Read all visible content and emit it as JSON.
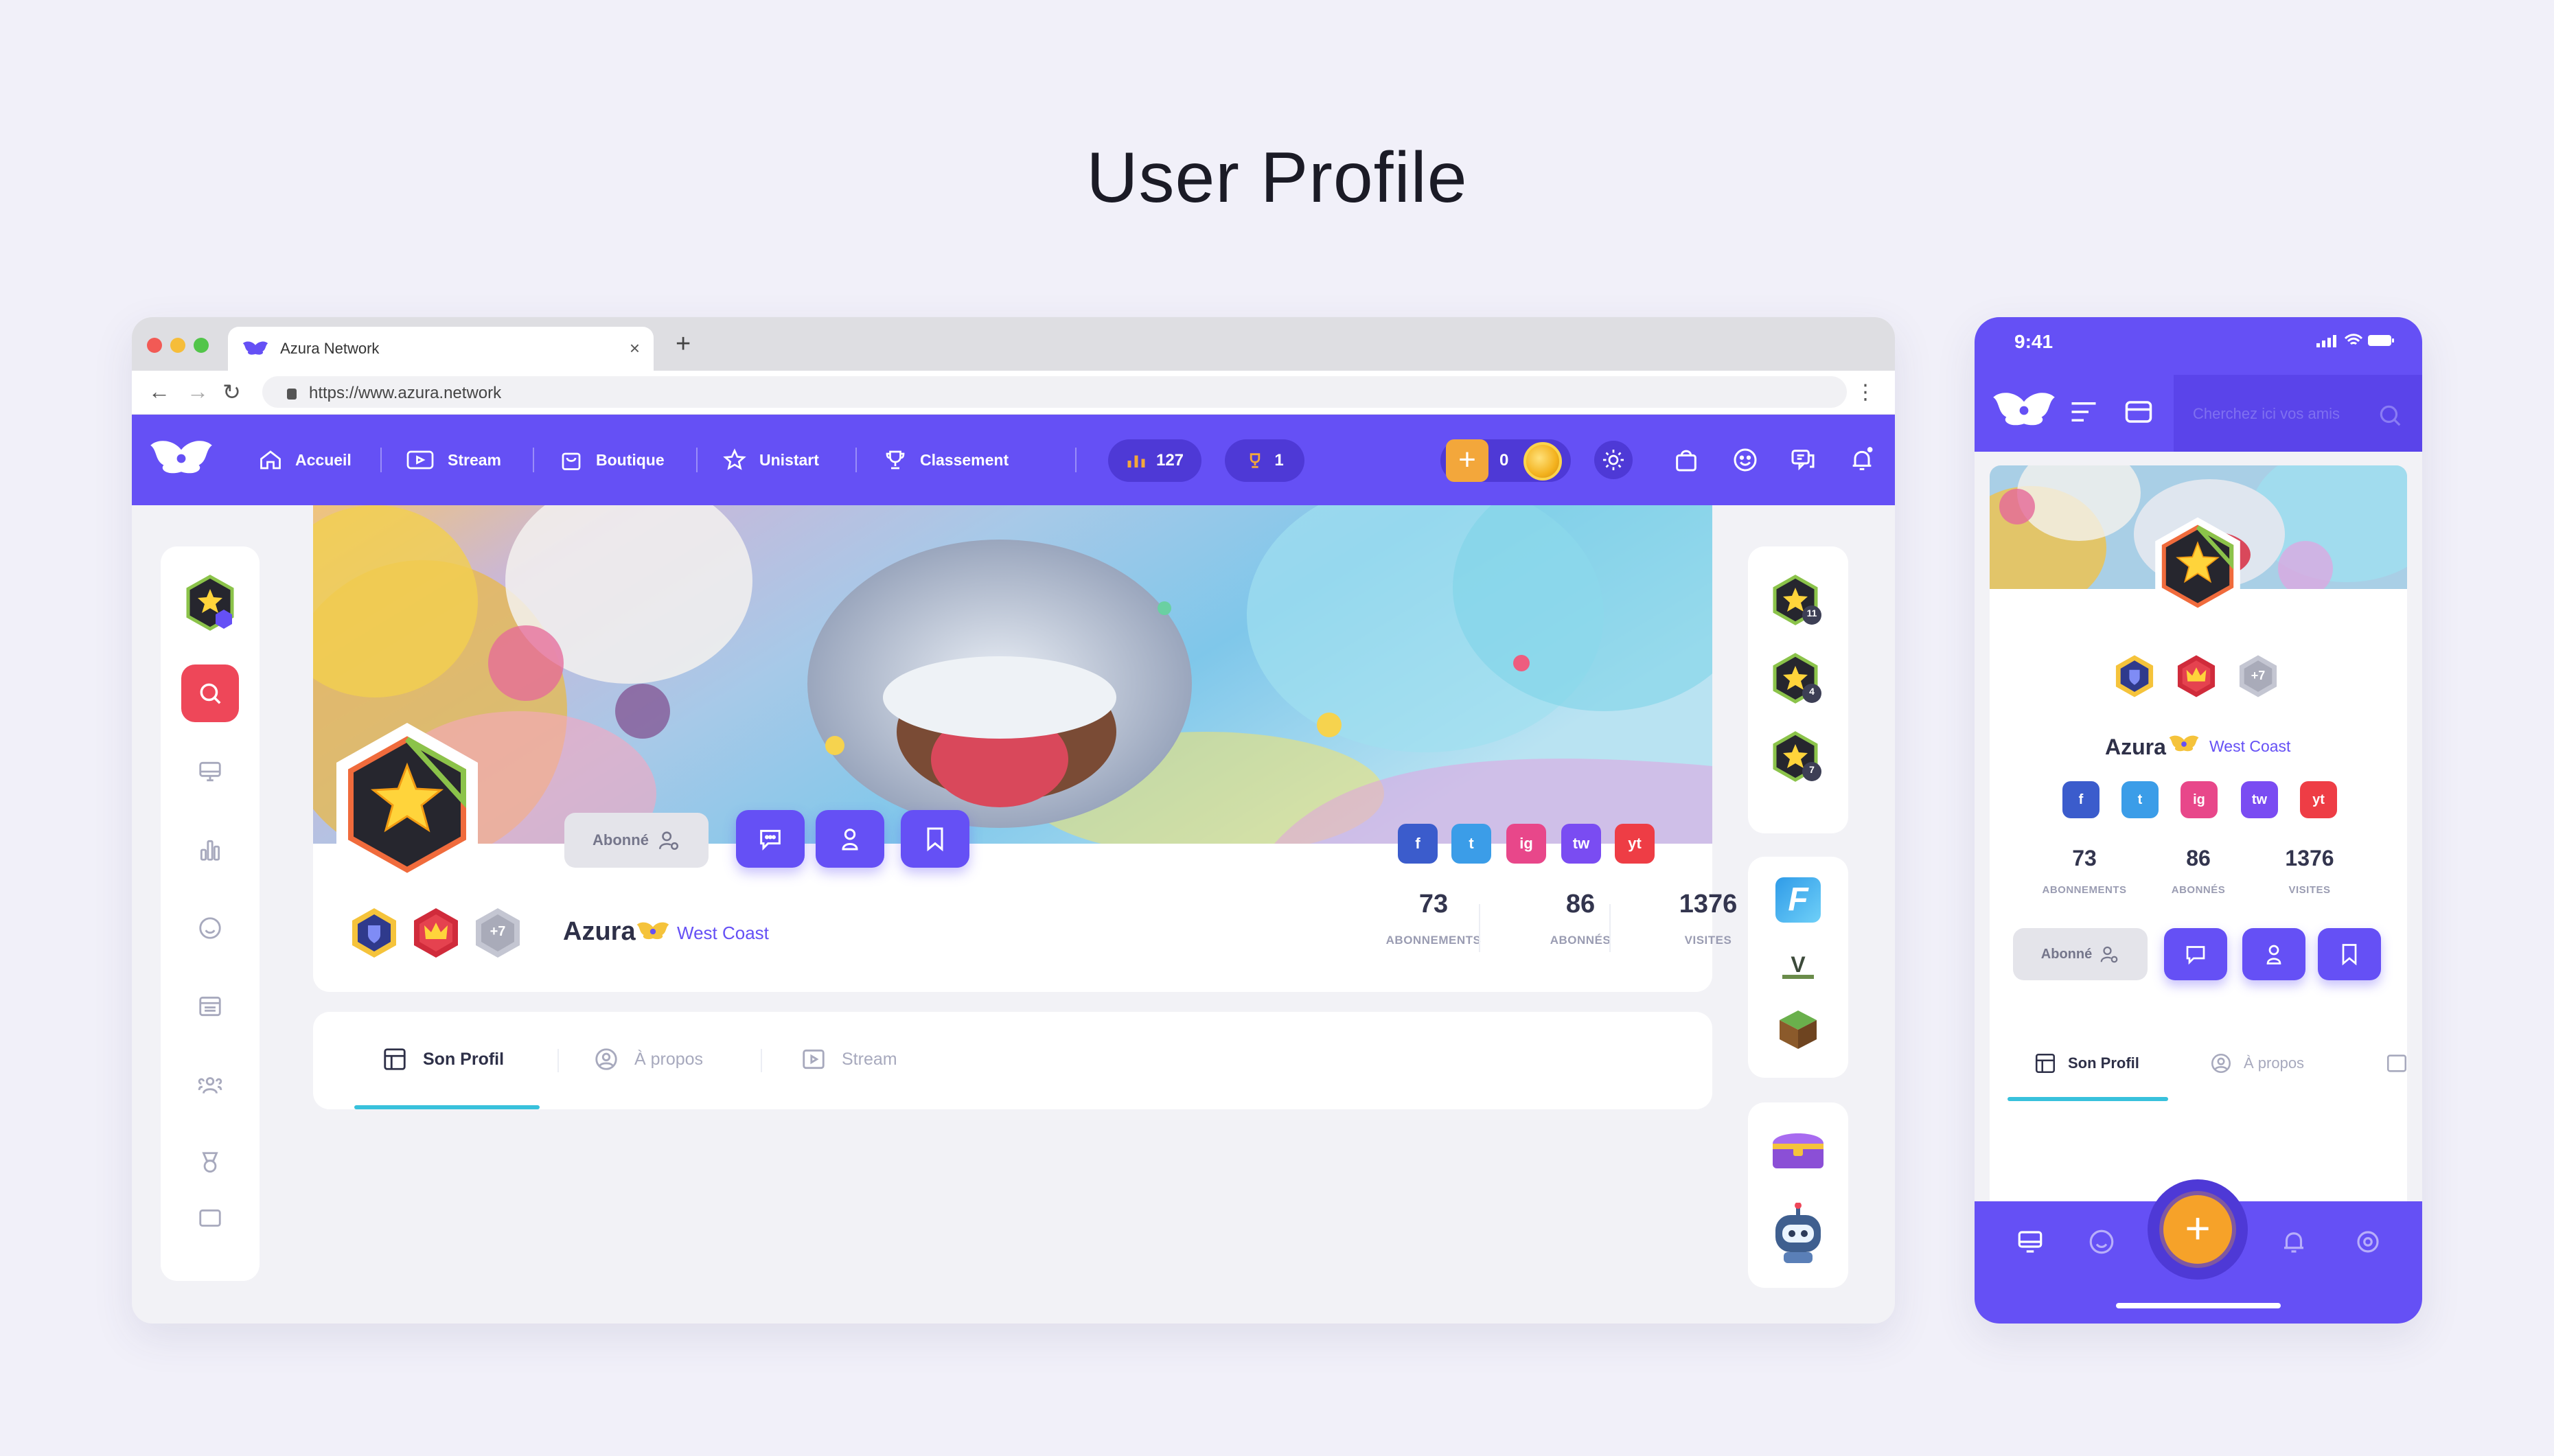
{
  "page": {
    "title": "User Profile"
  },
  "colors": {
    "brand": "#6550f5",
    "brand_dark": "#4e39d6",
    "accent_red": "#ee4759",
    "accent_cyan": "#38c1dc",
    "coin": "#f3b21e"
  },
  "browser": {
    "tab_title": "Azura Network",
    "tab_close": "×",
    "new_tab": "+",
    "url": "https://www.azura.network"
  },
  "nav": {
    "items": [
      {
        "label": "Accueil",
        "icon": "home-icon"
      },
      {
        "label": "Stream",
        "icon": "play-icon"
      },
      {
        "label": "Boutique",
        "icon": "bag-icon"
      },
      {
        "label": "Unistart",
        "icon": "star-icon"
      },
      {
        "label": "Classement",
        "icon": "trophy-icon"
      }
    ],
    "viewers": "127",
    "trophies": "1",
    "coins": "0",
    "coin_plus": "+"
  },
  "profile": {
    "name": "Azura",
    "team": "West Coast",
    "badges_more": "+7",
    "subscribe_label": "Abonné",
    "stats": [
      {
        "value": "73",
        "label": "ABONNEMENTS"
      },
      {
        "value": "86",
        "label": "ABONNÉS"
      },
      {
        "value": "1376",
        "label": "VISITES"
      }
    ],
    "socials": [
      "f",
      "t",
      "ig",
      "tw",
      "yt"
    ]
  },
  "tabs": [
    {
      "label": "Son Profil",
      "icon": "layout-icon"
    },
    {
      "label": "À propos",
      "icon": "user-circle-icon"
    },
    {
      "label": "Stream",
      "icon": "play-icon"
    }
  ],
  "right_sidebar": {
    "levels": [
      "11",
      "4",
      "7"
    ],
    "games": [
      "fortnite",
      "gta",
      "minecraft"
    ]
  },
  "phone": {
    "time": "9:41",
    "search_placeholder": "Cherchez ici vos amis",
    "fab": "+"
  }
}
